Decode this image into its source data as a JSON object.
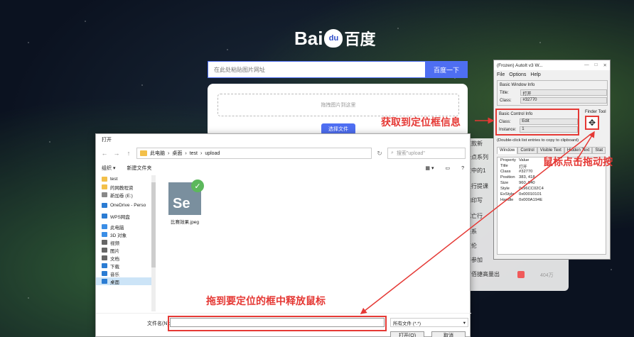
{
  "baidu": {
    "logo_text": "Bai",
    "logo_paw": "du",
    "logo_cn": "百度",
    "search_placeholder": "在此处粘贴图片网址",
    "search_button": "百度一下",
    "drop_hint": "拖拽图片到这里",
    "choose_button": "选择文件",
    "bg_lines": [
      "这款新",
      "卡点系列",
      "文中的1",
      "是行提课",
      "加印写",
      "死亡行",
      "关系",
      "艾伦",
      "将参加",
      "打信号"
    ],
    "bg_last": "打佰捷高量出",
    "bg_last_count": "404万"
  },
  "dialog": {
    "title": "打开",
    "breadcrumb": [
      "此电脑",
      "桌面",
      "test",
      "upload"
    ],
    "search_placeholder": "搜索\"upload\"",
    "organize": "组织 ▾",
    "new_folder": "新建文件夹",
    "sidebar": [
      {
        "label": "test",
        "color": "#f3c04a"
      },
      {
        "label": "的网教程资",
        "color": "#f3c04a"
      },
      {
        "label": "新加卷 (E:)",
        "color": "#888"
      },
      {
        "label": "OneDrive - Perso",
        "color": "#2b7cd3"
      },
      {
        "label": "WPS网盘",
        "color": "#2b7cd3"
      },
      {
        "label": "此电脑",
        "color": "#3a8ee6"
      },
      {
        "label": "3D 对象",
        "color": "#3a8ee6"
      },
      {
        "label": "视频",
        "color": "#666"
      },
      {
        "label": "图片",
        "color": "#666"
      },
      {
        "label": "文档",
        "color": "#666"
      },
      {
        "label": "下载",
        "color": "#2b7cd3"
      },
      {
        "label": "音乐",
        "color": "#2b7cd3"
      },
      {
        "label": "桌面",
        "color": "#2b7cd3"
      }
    ],
    "file_icon_text": "Se",
    "file_name": "比赛效果.jpeg",
    "filename_label": "文件名(N):",
    "filetype": "所有文件 (*.*)",
    "open_button": "打开(O)",
    "cancel_button": "取消"
  },
  "autoit": {
    "title": "(Frozen) AutoIt v3 W...",
    "menu": [
      "File",
      "Options",
      "Help"
    ],
    "basic_window_info": "Basic Window Info",
    "title_label": "Title:",
    "title_value": "打开",
    "class_label": "Class:",
    "class_value": "#32770",
    "basic_control_info": "Basic Control Info",
    "ctrl_class_label": "Class:",
    "ctrl_class_value": "Edit",
    "instance_label": "Instance:",
    "instance_value": "1",
    "finder_tool": "Finder Tool",
    "hint": "(Double-click list entries to copy to clipboard)",
    "tabs": [
      "Window",
      "Control",
      "Visible Text",
      "Hidden Text",
      "Stat"
    ],
    "table_header": [
      "Property",
      "Value"
    ],
    "table": [
      [
        "Title",
        "打开"
      ],
      [
        "Class",
        "#32770"
      ],
      [
        "Position",
        "383, 418"
      ],
      [
        "Size",
        "960, 540"
      ],
      [
        "Style",
        "0x96CC02C4"
      ],
      [
        "ExStyle",
        "0x00010101"
      ],
      [
        "Handle",
        "0x000A194E"
      ]
    ]
  },
  "annotations": {
    "get_info": "获取到定位框信息",
    "drag_tool": "鼠标点击拖动按",
    "release": "拖到要定位的框中释放鼠标",
    "red": "#e53935"
  }
}
